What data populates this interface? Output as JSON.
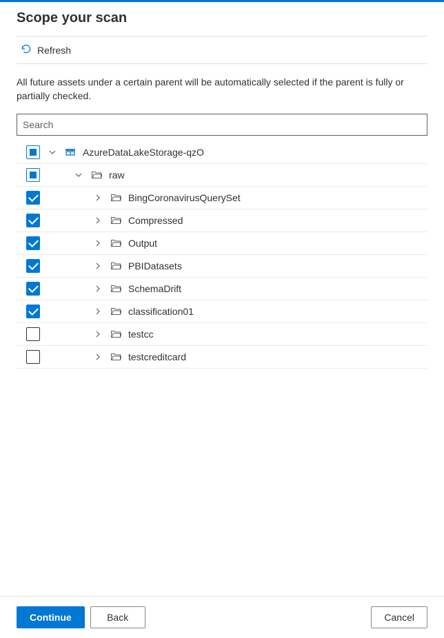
{
  "title": "Scope your scan",
  "toolbar": {
    "refresh_label": "Refresh"
  },
  "description": "All future assets under a certain parent will be automatically selected if the parent is fully or partially checked.",
  "search": {
    "placeholder": "Search",
    "value": ""
  },
  "tree": {
    "root": {
      "label": "AzureDataLakeStorage-qzO",
      "check_state": "partial",
      "expanded": true,
      "icon": "storage"
    },
    "level1": {
      "label": "raw",
      "check_state": "partial",
      "expanded": true,
      "icon": "folder"
    },
    "items": [
      {
        "label": "BingCoronavirusQuerySet",
        "check_state": "checked",
        "expanded": false,
        "icon": "folder"
      },
      {
        "label": "Compressed",
        "check_state": "checked",
        "expanded": false,
        "icon": "folder"
      },
      {
        "label": "Output",
        "check_state": "checked",
        "expanded": false,
        "icon": "folder"
      },
      {
        "label": "PBIDatasets",
        "check_state": "checked",
        "expanded": false,
        "icon": "folder"
      },
      {
        "label": "SchemaDrift",
        "check_state": "checked",
        "expanded": false,
        "icon": "folder"
      },
      {
        "label": "classification01",
        "check_state": "checked",
        "expanded": false,
        "icon": "folder"
      },
      {
        "label": "testcc",
        "check_state": "unchecked",
        "expanded": false,
        "icon": "folder"
      },
      {
        "label": "testcreditcard",
        "check_state": "unchecked",
        "expanded": false,
        "icon": "folder"
      }
    ]
  },
  "footer": {
    "continue_label": "Continue",
    "back_label": "Back",
    "cancel_label": "Cancel"
  }
}
